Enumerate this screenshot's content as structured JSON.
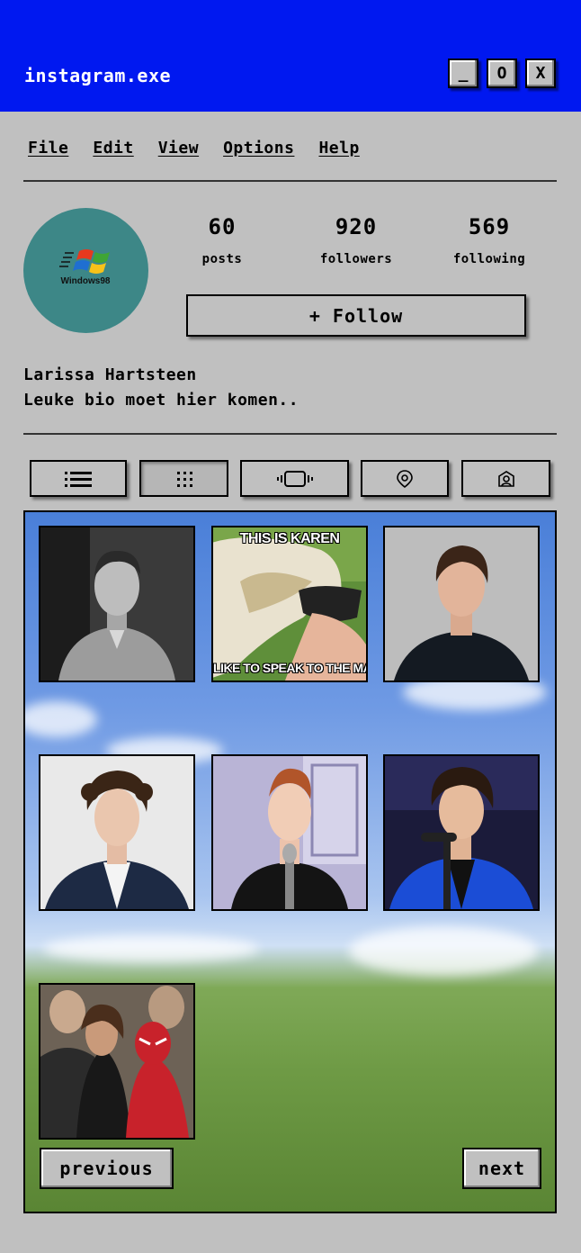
{
  "window": {
    "title": "instagram.exe",
    "minimize_label": "_",
    "maximize_label": "O",
    "close_label": "X"
  },
  "menu": [
    "File",
    "Edit",
    "View",
    "Options",
    "Help"
  ],
  "profile": {
    "avatar_text": "Windows98",
    "stats": [
      {
        "value": "60",
        "label": "posts"
      },
      {
        "value": "920",
        "label": "followers"
      },
      {
        "value": "569",
        "label": "following"
      }
    ],
    "follow_label": "+ Follow",
    "name": "Larissa Hartsteen",
    "bio": "Leuke bio moet hier komen.."
  },
  "view_tabs": [
    {
      "icon": "list-icon"
    },
    {
      "icon": "grid-icon",
      "active": true
    },
    {
      "icon": "reels-icon"
    },
    {
      "icon": "location-icon"
    },
    {
      "icon": "tagged-icon"
    }
  ],
  "posts": [
    {
      "subject": "man-bw-portrait"
    },
    {
      "subject": "karen-meme",
      "top_text": "THIS IS KAREN",
      "bottom_text": "LIKE TO SPEAK TO THE MA"
    },
    {
      "subject": "man-dark-shirt"
    },
    {
      "subject": "curly-hair-suit"
    },
    {
      "subject": "singer-microphone"
    },
    {
      "subject": "singer-blue-jacket"
    },
    {
      "subject": "crowd-photo"
    }
  ],
  "pagination": {
    "previous_label": "previous",
    "next_label": "next"
  }
}
